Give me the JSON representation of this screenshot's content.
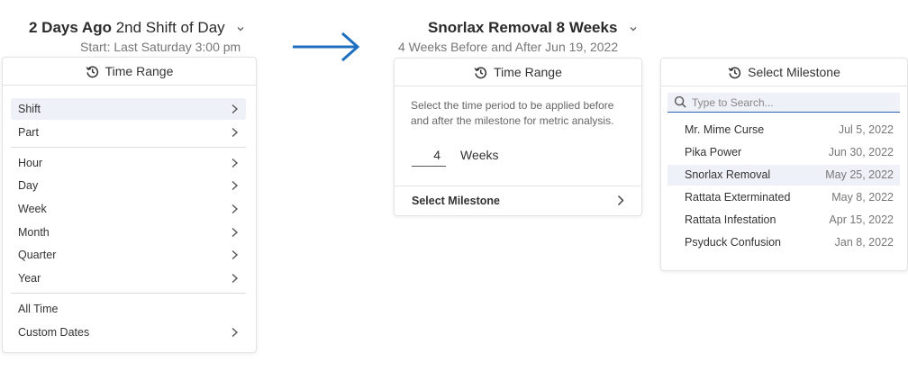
{
  "left": {
    "title_bold": "2 Days Ago",
    "title_rest": "2nd Shift of Day",
    "subtitle": "Start: Last Saturday 3:00 pm",
    "panel_title": "Time Range",
    "group1": [
      {
        "label": "Shift",
        "active": true
      },
      {
        "label": "Part",
        "active": false
      }
    ],
    "group2": [
      {
        "label": "Hour"
      },
      {
        "label": "Day"
      },
      {
        "label": "Week"
      },
      {
        "label": "Month"
      },
      {
        "label": "Quarter"
      },
      {
        "label": "Year"
      }
    ],
    "group3": [
      {
        "label": "All Time",
        "chevron": false
      },
      {
        "label": "Custom Dates",
        "chevron": true
      }
    ]
  },
  "middle": {
    "title": "Snorlax Removal 8 Weeks",
    "subtitle": "4 Weeks Before and After Jun 19, 2022",
    "panel_title": "Time Range",
    "description_line1": "Select the time period to be applied before",
    "description_line2": "and after the milestone for metric analysis.",
    "weeks_value": "4",
    "weeks_label": "Weeks",
    "select_milestone": "Select Milestone"
  },
  "right": {
    "panel_title": "Select Milestone",
    "search_placeholder": "Type to Search...",
    "milestones": [
      {
        "name": "Mr. Mime Curse",
        "date": "Jul 5, 2022",
        "active": false
      },
      {
        "name": "Pika Power",
        "date": "Jun 30, 2022",
        "active": false
      },
      {
        "name": "Snorlax Removal",
        "date": "May 25, 2022",
        "active": true
      },
      {
        "name": "Rattata Exterminated",
        "date": "May 8, 2022",
        "active": false
      },
      {
        "name": "Rattata Infestation",
        "date": "Apr 15, 2022",
        "active": false
      },
      {
        "name": "Psyduck Confusion",
        "date": "Jan 8, 2022",
        "active": false
      }
    ]
  },
  "colors": {
    "accent": "#2a64b0",
    "arrow": "#1f6fc0",
    "highlight": "#eef1f8"
  }
}
